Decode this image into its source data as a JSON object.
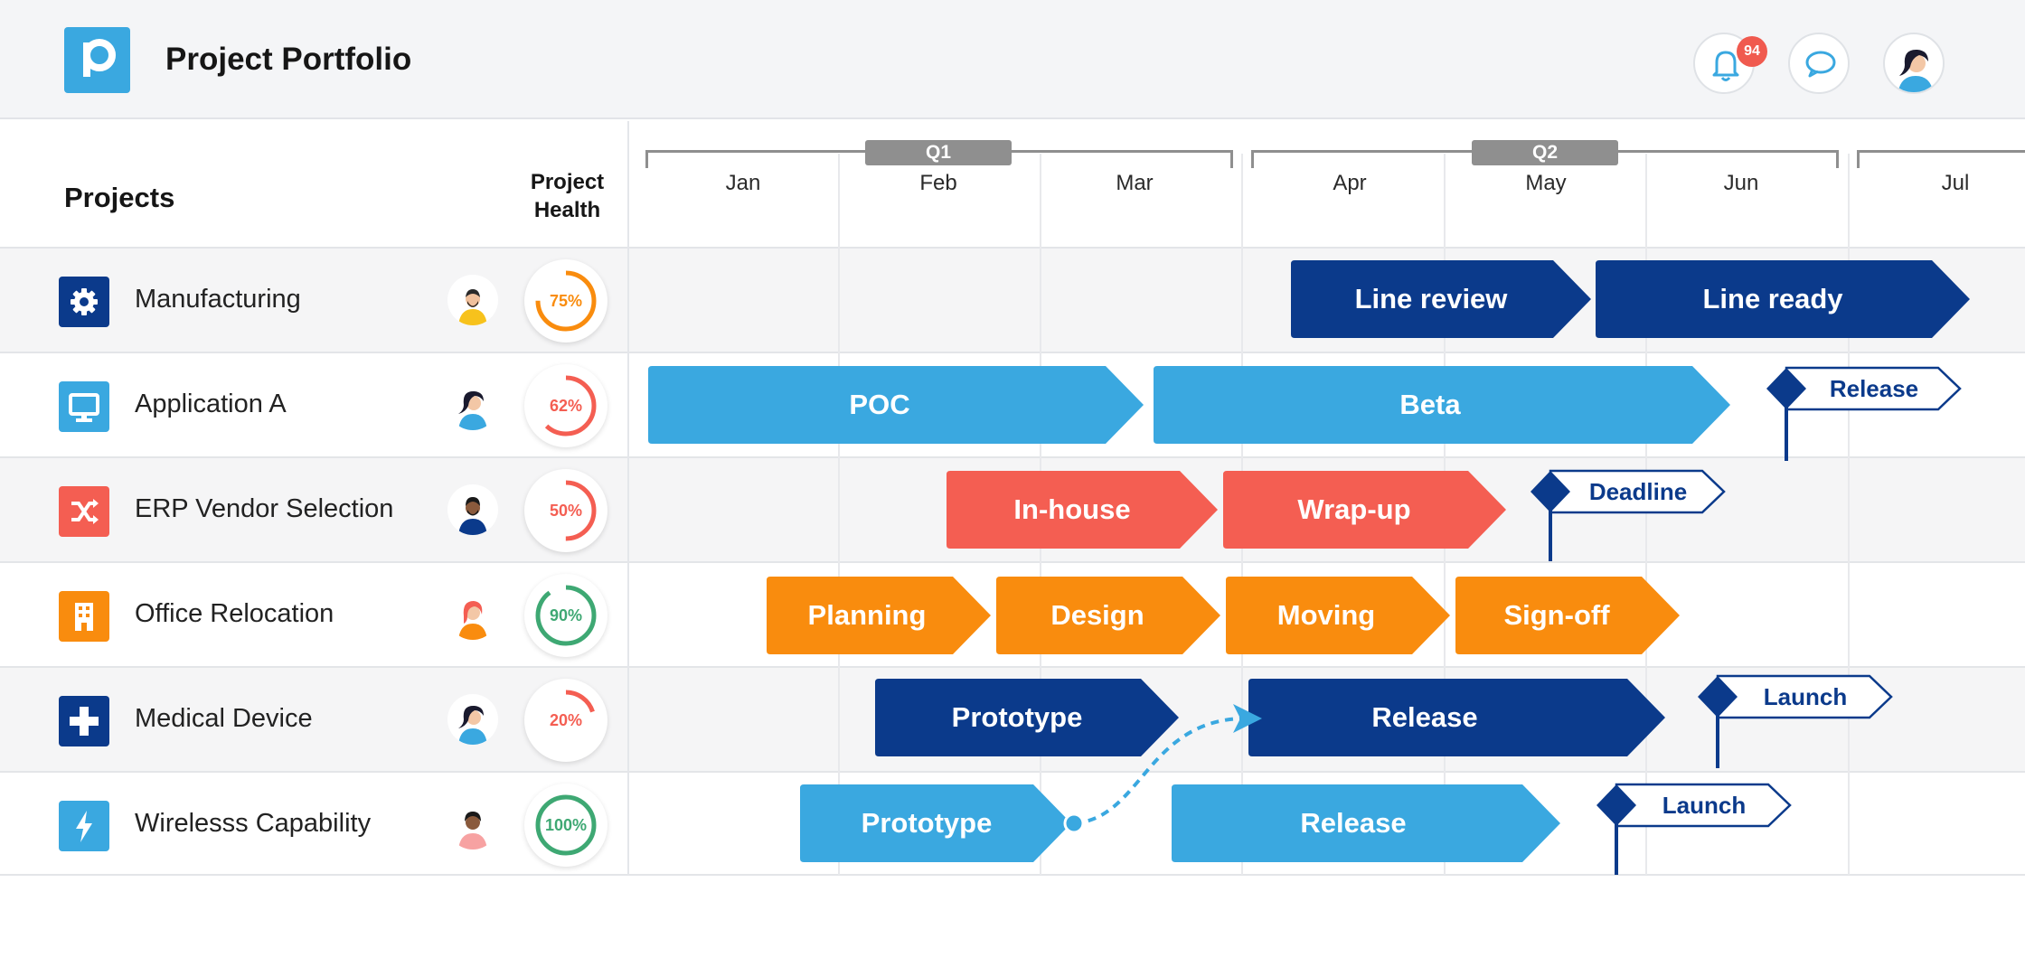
{
  "header": {
    "app_title": "Project Portfolio",
    "notification_count": "94",
    "logo_icon": "p-logo-icon",
    "icons": [
      "bell-icon",
      "chat-bubble-icon",
      "user-avatar"
    ]
  },
  "columns": {
    "projects": "Projects",
    "health_line1": "Project",
    "health_line2": "Health"
  },
  "timeline": {
    "quarters": [
      "Q1",
      "Q2"
    ],
    "months": [
      "Jan",
      "Feb",
      "Mar",
      "Apr",
      "May",
      "Jun",
      "Jul"
    ]
  },
  "colors": {
    "navy": "#0b3a8b",
    "sky": "#3aa8e0",
    "coral": "#f45e52",
    "orange": "#f98c0e",
    "good": "#3ea873",
    "warn": "#f98c0e",
    "bad": "#f45e52"
  },
  "projects": [
    {
      "name": "Manufacturing",
      "icon": "gear-icon",
      "health": "75%",
      "tasks": [
        "Line review",
        "Line ready"
      ],
      "milestones": []
    },
    {
      "name": "Application A",
      "icon": "monitor-icon",
      "health": "62%",
      "tasks": [
        "POC",
        "Beta"
      ],
      "milestones": [
        "Release"
      ]
    },
    {
      "name": "ERP Vendor Selection",
      "icon": "shuffle-icon",
      "health": "50%",
      "tasks": [
        "In-house",
        "Wrap-up"
      ],
      "milestones": [
        "Deadline"
      ]
    },
    {
      "name": "Office Relocation",
      "icon": "building-icon",
      "health": "90%",
      "tasks": [
        "Planning",
        "Design",
        "Moving",
        "Sign-off"
      ],
      "milestones": []
    },
    {
      "name": "Medical Device",
      "icon": "medical-cross-icon",
      "health": "20%",
      "tasks": [
        "Prototype",
        "Release"
      ],
      "milestones": [
        "Launch"
      ]
    },
    {
      "name": "Wirelesss Capability",
      "icon": "lightning-icon",
      "health": "100%",
      "tasks": [
        "Prototype",
        "Release"
      ],
      "milestones": [
        "Launch"
      ]
    }
  ]
}
